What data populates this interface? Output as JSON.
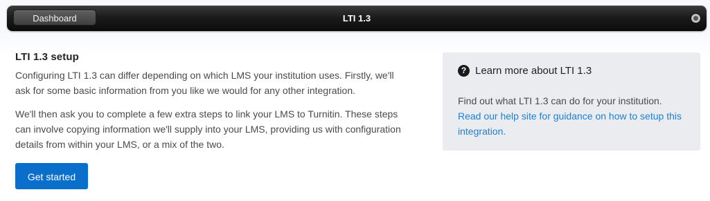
{
  "topbar": {
    "dashboard_label": "Dashboard",
    "title": "LTI 1.3"
  },
  "main": {
    "heading": "LTI 1.3 setup",
    "paragraph_1": "Configuring LTI 1.3 can differ depending on which LMS your institution uses. Firstly, we'll ask for some basic information from you like we would for any other integration.",
    "paragraph_2": "We'll then ask you to complete a few extra steps to link your LMS to Turnitin. These steps can involve copying information we'll supply into your LMS, providing us with configuration details from within your LMS, or a mix of the two.",
    "get_started_label": "Get started"
  },
  "side_panel": {
    "icon": "question-circle-icon",
    "icon_glyph": "?",
    "title": "Learn more about LTI 1.3",
    "text": "Find out what LTI 1.3 can do for your institution.",
    "link_text": "Read our help site for guidance on how to setup this integration."
  },
  "colors": {
    "primary_button": "#0a6ecb",
    "link": "#1e7fd6",
    "panel_background": "#ebecf0",
    "topbar": "#1c1c1c"
  }
}
